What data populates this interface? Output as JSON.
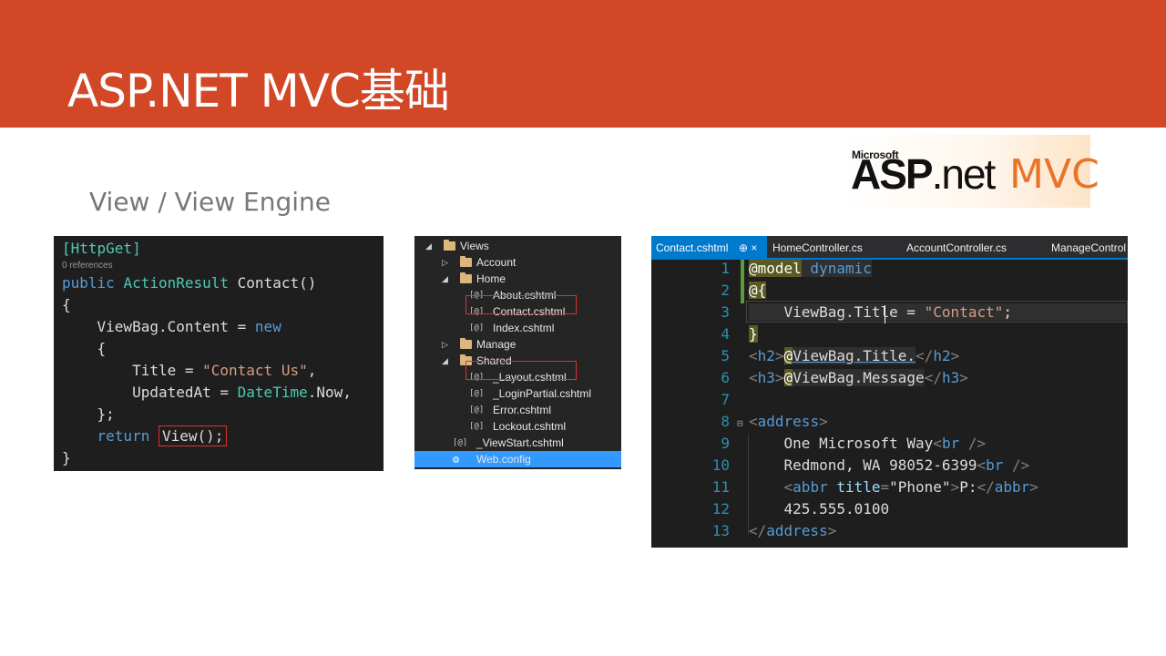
{
  "header": {
    "title": "ASP.NET MVC基础"
  },
  "subtitle": "View / View Engine",
  "logo": {
    "microsoft": "Microsoft",
    "asp": "ASP",
    "net": ".net",
    "mvc": "MVC"
  },
  "colors": {
    "accent": "#d24726",
    "code_bg": "#1e1e1e",
    "keyword": "#569cd6",
    "type": "#4ec9b0",
    "string": "#d69d85",
    "selection": "#3399ff",
    "highlight_box": "#e03030"
  },
  "controller_code": {
    "attribute": "[HttpGet]",
    "references": "0 references",
    "kw_public": "public",
    "return_type": "ActionResult",
    "method": " Contact()",
    "open_brace": "{",
    "viewbag_line": "    ViewBag.Content = ",
    "kw_new": "new",
    "inner_open": "    {",
    "title_prefix": "        Title = ",
    "title_value": "\"Contact Us\"",
    "title_suffix": ",",
    "updated_prefix": "        UpdatedAt = ",
    "updated_type": "DateTime",
    "updated_suffix": ".Now,",
    "inner_close": "    };",
    "kw_return": "return",
    "view_call": "View();",
    "close_brace": "}"
  },
  "solution_tree": [
    {
      "label": "Views",
      "kind": "folder",
      "expanded": true
    },
    {
      "label": "Account",
      "kind": "folder",
      "expanded": false
    },
    {
      "label": "Home",
      "kind": "folder",
      "expanded": true
    },
    {
      "label": "About.cshtml",
      "kind": "razor"
    },
    {
      "label": "Contact.cshtml",
      "kind": "razor",
      "highlighted": true
    },
    {
      "label": "Index.cshtml",
      "kind": "razor"
    },
    {
      "label": "Manage",
      "kind": "folder",
      "expanded": false
    },
    {
      "label": "Shared",
      "kind": "folder",
      "expanded": true
    },
    {
      "label": "_Layout.cshtml",
      "kind": "razor",
      "highlighted": true
    },
    {
      "label": "_LoginPartial.cshtml",
      "kind": "razor"
    },
    {
      "label": "Error.cshtml",
      "kind": "razor"
    },
    {
      "label": "Lockout.cshtml",
      "kind": "razor"
    },
    {
      "label": "_ViewStart.cshtml",
      "kind": "razor"
    },
    {
      "label": "Web.config",
      "kind": "config",
      "selected": true
    }
  ],
  "tree_icon_glyph": "[@]",
  "editor": {
    "tabs": [
      {
        "label": "Contact.cshtml",
        "active": true,
        "pin": "⊕ ×"
      },
      {
        "label": "HomeController.cs"
      },
      {
        "label": "AccountController.cs"
      },
      {
        "label": "ManageControl"
      }
    ],
    "line_numbers": [
      "1",
      "2",
      "3",
      "4",
      "5",
      "6",
      "7",
      "8",
      "9",
      "10",
      "11",
      "12",
      "13"
    ],
    "line1": {
      "at": "@model",
      "kw": " dynamic"
    },
    "line2": {
      "at": "@{"
    },
    "line3": {
      "text": "    ViewBag.Title = ",
      "str": "\"Contact\"",
      "end": ";"
    },
    "line4": {
      "at": "}"
    },
    "line5": {
      "open": "<",
      "tag": "h2",
      "close": ">",
      "at": "@",
      "expr": "ViewBag.Title.",
      "end_open": "</",
      "end_tag": "h2",
      "end_close": ">"
    },
    "line6": {
      "open": "<",
      "tag": "h3",
      "close": ">",
      "at": "@",
      "expr": "ViewBag.Message",
      "end_open": "</",
      "end_tag": "h3",
      "end_close": ">"
    },
    "line8": {
      "open": "<",
      "tag": "address",
      "close": ">"
    },
    "line9": {
      "text": "    One Microsoft Way",
      "br_open": "<",
      "br": "br",
      "br_close": " />"
    },
    "line10": {
      "text": "    Redmond, WA 98052-6399",
      "br_open": "<",
      "br": "br",
      "br_close": " />"
    },
    "line11": {
      "indent": "    ",
      "open": "<",
      "tag": "abbr",
      "attr": " title",
      "eq": "=",
      "val": "\"Phone\"",
      "close": ">",
      "text": "P:",
      "end_open": "</",
      "end_tag": "abbr",
      "end_close": ">"
    },
    "line12": {
      "text": "    425.555.0100"
    },
    "line13": {
      "open": "</",
      "tag": "address",
      "close": ">"
    }
  }
}
